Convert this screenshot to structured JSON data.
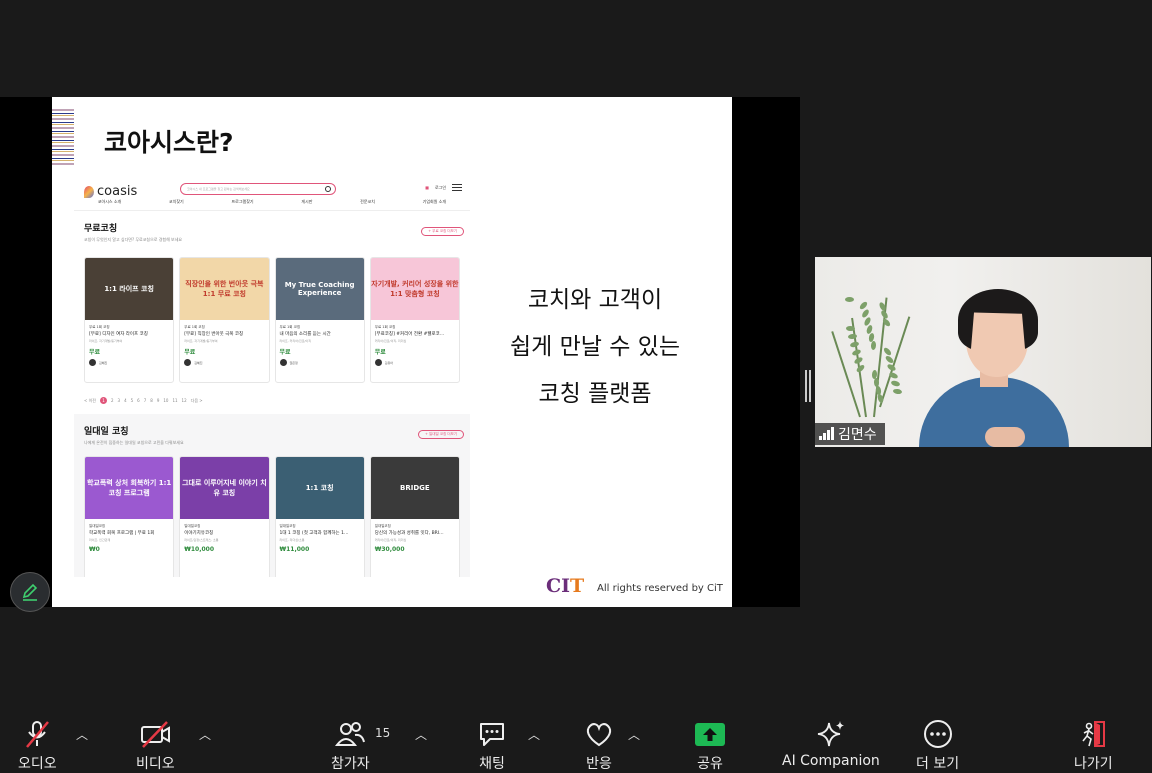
{
  "slide": {
    "title": "코아시스란?",
    "tagline_1": "코치와 고객이",
    "tagline_2": "쉽게 만날 수 있는",
    "tagline_3": "코칭 플랫폼",
    "footer_logo_a": "CI",
    "footer_logo_b": "T",
    "footer_text": "All rights reserved by CiT"
  },
  "site": {
    "logo": "coasis",
    "search_placeholder": "코아시스 내 프로그램을 찾고 원하는 검색해보세요",
    "login": "로그인",
    "nav": [
      "코아시스 소개",
      "코치찾기",
      "프로그램찾기",
      "게시판",
      "전문코치",
      "기업회원 소개"
    ],
    "free": {
      "heading": "무료코칭",
      "sub": "코칭이 무엇인지 알고 싶다면? 무료코칭으로 경험해 보세요",
      "more": "+ 무료 코칭 더보기",
      "cards": [
        {
          "thumb": "1:1 라이프 코칭",
          "label": "무료 1회 코칭",
          "title": "[무료] 디자인 여자 라이프 코칭",
          "meta": "라이프, 자기계발/동기부여",
          "price": "무료",
          "coach": "김혜진",
          "thumb_color": "#4a4036"
        },
        {
          "thumb": "직장인을 위한 번아웃 극복 1:1 무료 코칭",
          "label": "무료 1회 코칭",
          "title": "[무료] 직장인 번아웃 극복 코칭",
          "meta": "라이프, 자기계발/동기부여",
          "price": "무료",
          "coach": "김혜진",
          "thumb_color": "#f2d7a8"
        },
        {
          "thumb": "My True Coaching Experience",
          "label": "무료 1회 코칭",
          "title": "내 마음의 소리를 듣는 시간",
          "meta": "라이프, 커리어/진로/이직",
          "price": "무료",
          "coach": "권은정",
          "thumb_color": "#5a6b7c"
        },
        {
          "thumb": "자기개발, 커리어 성장을 위한 1:1 맞춤형 코칭",
          "label": "무료 1회 코칭",
          "title": "[무료코칭] #커리어 전환 #웰로코…",
          "meta": "커리어/진로/이직, 리더십",
          "price": "무료",
          "coach": "김유아",
          "thumb_color": "#f7c6d8"
        }
      ],
      "pager": [
        "< 이전",
        "1",
        "2",
        "3",
        "4",
        "5",
        "6",
        "7",
        "8",
        "9",
        "10",
        "11",
        "12",
        "다음 >"
      ]
    },
    "one": {
      "heading": "일대일 코칭",
      "sub": "나에게 온전히 집중하는 일대일 코칭으로 고민을 다뤄보세요",
      "more": "+ 일대일 코칭 더보기",
      "cards": [
        {
          "thumb": "학교폭력 상처 회복하기 1:1 코칭 프로그램",
          "label": "일대일코칭",
          "title": "학교폭력 회복 프로그램 | 무료 1회",
          "meta": "라이프, 인간관계",
          "price": "₩0",
          "thumb_color": "#9b59d0"
        },
        {
          "thumb": "그대로 이루어지네 이야기 치유 코칭",
          "label": "일대일코칭",
          "title": "이야기치유코칭",
          "meta": "라이프/감정/스트레스, 소통",
          "price": "₩10,000",
          "thumb_color": "#7b3fa8"
        },
        {
          "thumb": "1:1 코칭",
          "label": "일대일코칭",
          "title": "1대 1 코칭 (첫 고객과 함께하는 1…",
          "meta": "라이프, 리더십/소통",
          "price": "₩11,000",
          "thumb_color": "#3b5f73"
        },
        {
          "thumb": "BRIDGE",
          "label": "일대일코칭",
          "title": "당신의 가능성과 성취를 잇다, BRI…",
          "meta": "커리어/진로/이직, 리더십",
          "price": "₩30,000",
          "thumb_color": "#3a3a3a"
        }
      ]
    }
  },
  "participant": {
    "name": "김면수"
  },
  "toolbar": {
    "audio": "오디오",
    "video": "비디오",
    "participants": "참가자",
    "participants_count": "15",
    "chat": "채팅",
    "reactions": "반응",
    "share": "공유",
    "ai": "AI Companion",
    "more": "더 보기",
    "leave": "나가기"
  },
  "colors": {
    "accent": "#e0557a",
    "share_green": "#1db954",
    "leave_red": "#e53945"
  }
}
